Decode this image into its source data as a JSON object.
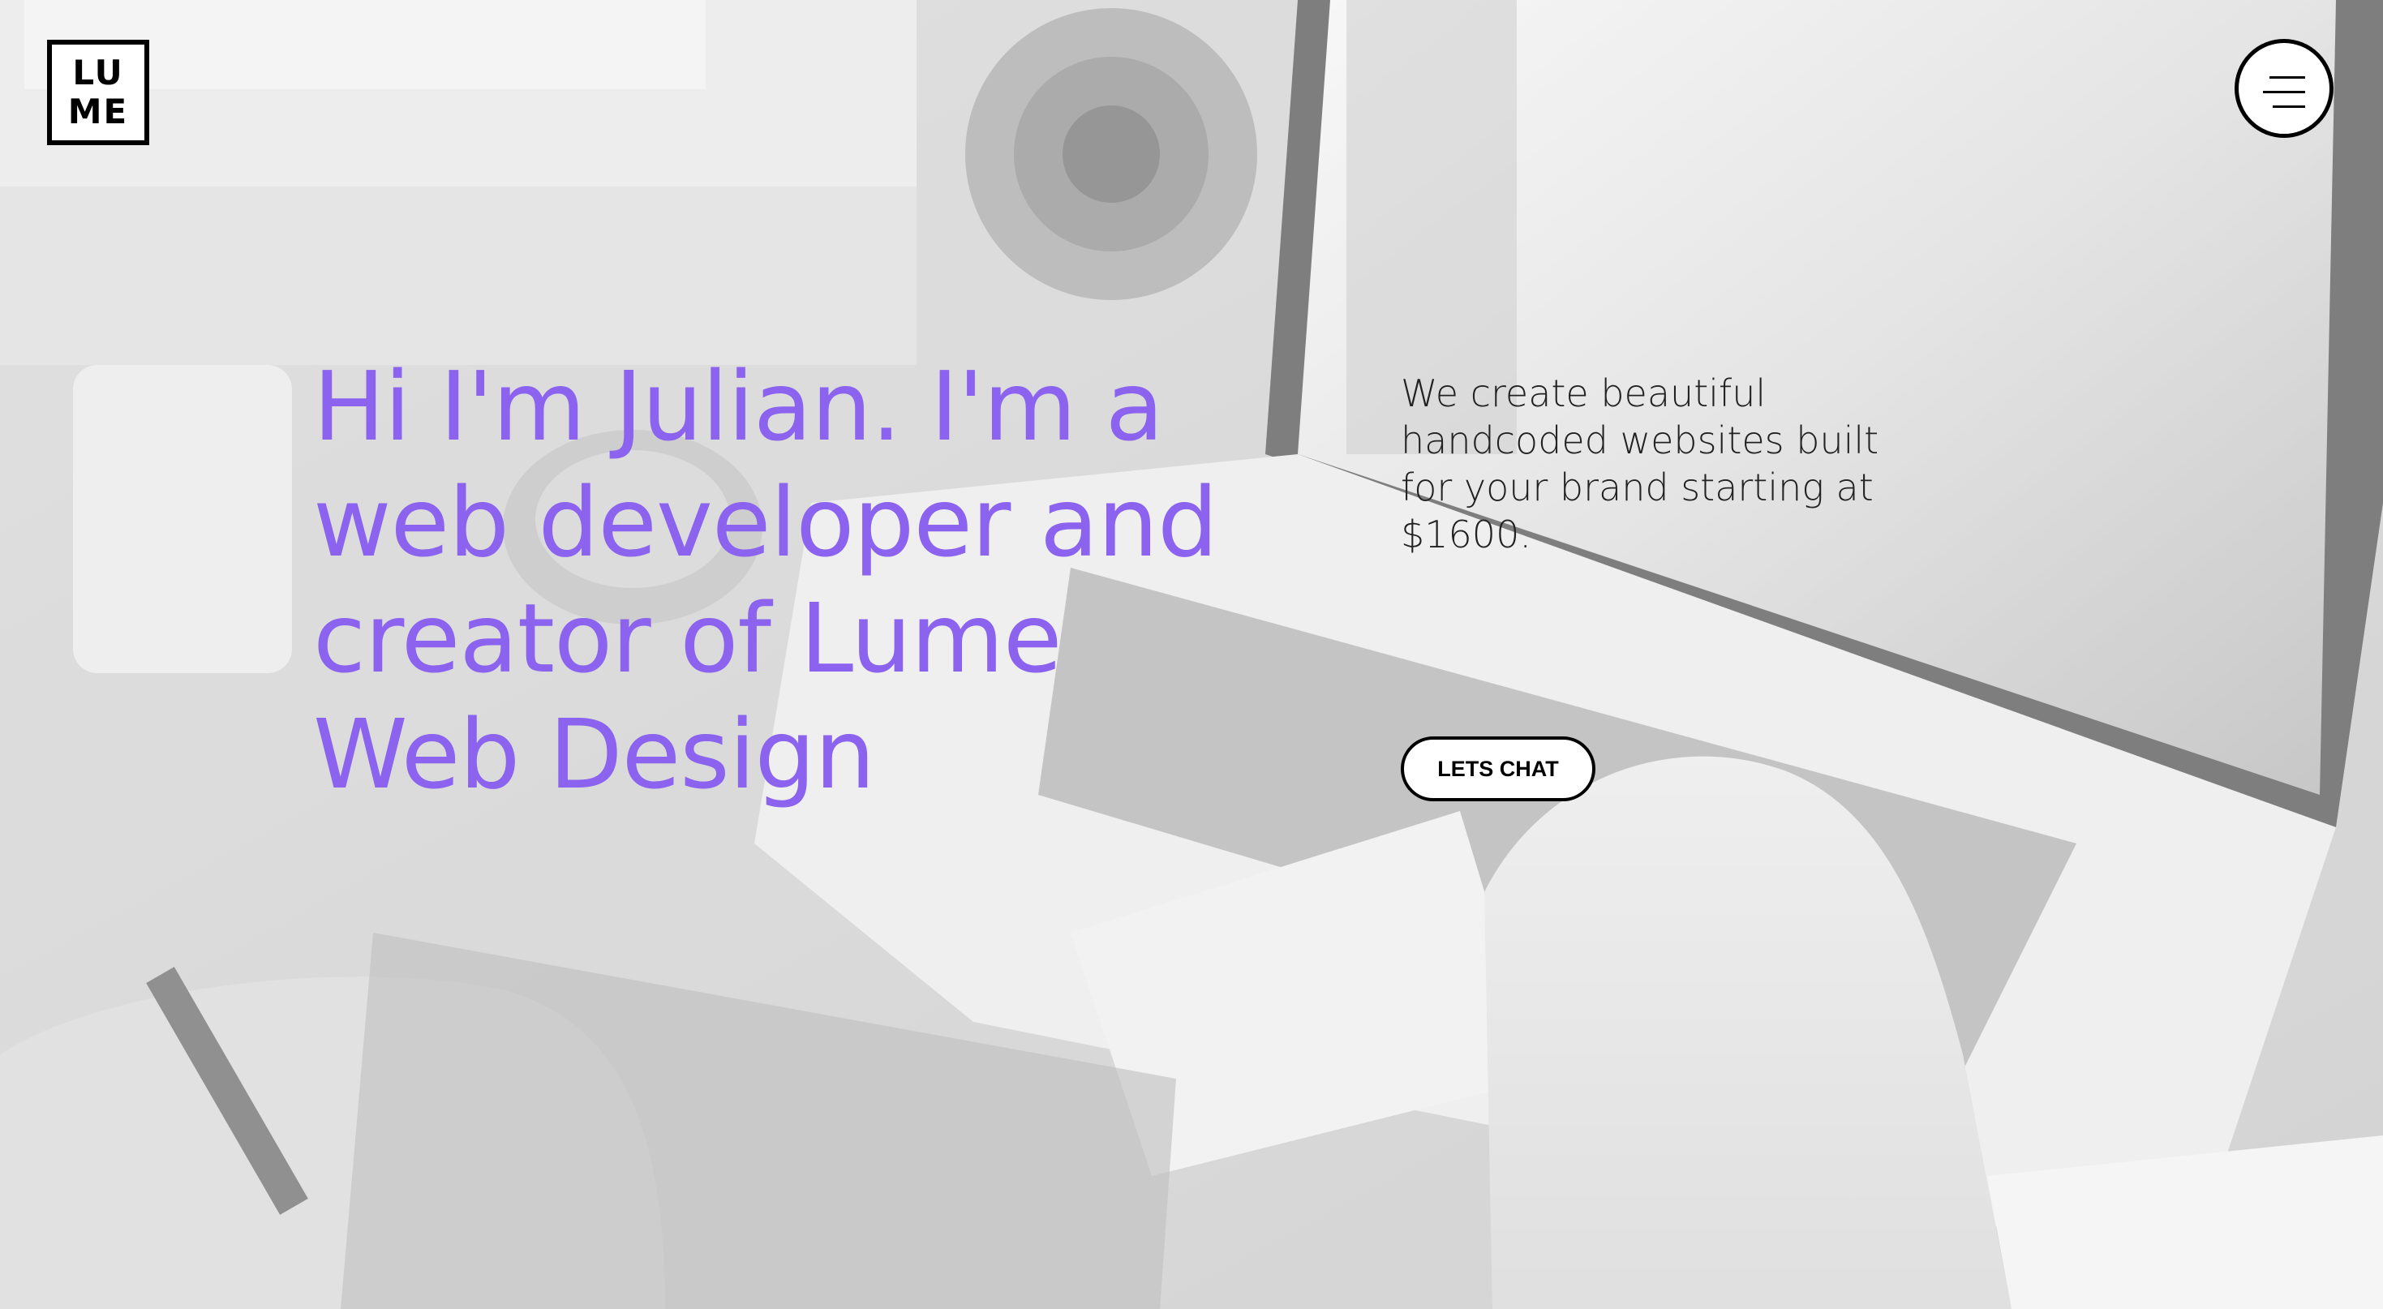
{
  "header": {
    "logo_line1": "LU",
    "logo_line2": "ME",
    "menu_icon": "hamburger-menu-icon"
  },
  "hero": {
    "headline": "Hi I'm Julian. I'm a web developer and creator of Lume Web Design",
    "tagline": "We create beautiful handcoded websites built for your brand starting at $1600.",
    "cta_label": "LETS CHAT"
  },
  "colors": {
    "accent": "#8c63ee",
    "text": "#222222",
    "button_border": "#000000",
    "background_tint": "#d9d9d9"
  }
}
